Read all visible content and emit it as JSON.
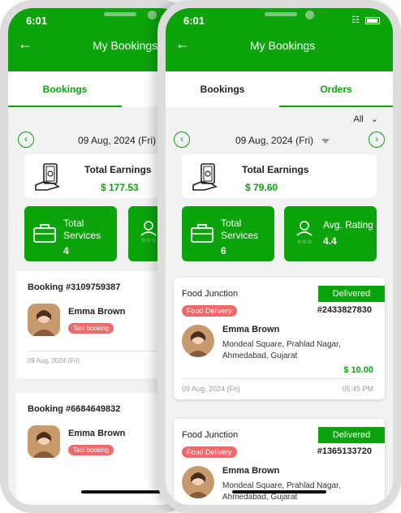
{
  "status": {
    "time": "6:01"
  },
  "header": {
    "title": "My Bookings"
  },
  "tabs_back": [
    {
      "label": "Bookings"
    }
  ],
  "tabs_front": [
    {
      "label": "Bookings"
    },
    {
      "label": "Orders"
    }
  ],
  "filter": {
    "label": "All"
  },
  "date": {
    "label": "09 Aug, 2024 (Fri)"
  },
  "earnings_back": {
    "label": "Total Earnings",
    "value": "$ 177.53"
  },
  "earnings_front": {
    "label": "Total Earnings",
    "value": "$ 79.60"
  },
  "services_back": {
    "label_line1": "Total",
    "label_line2": "Services",
    "value": "4"
  },
  "services_front": {
    "label_line1": "Total",
    "label_line2": "Services",
    "value": "6"
  },
  "rating_front": {
    "label": "Avg. Rating",
    "value": "4.4"
  },
  "bookings": [
    {
      "title": "Booking #3109759387",
      "name": "Emma Brown",
      "tag": "Taxi booking",
      "date": "09 Aug, 2024 (Fri)"
    },
    {
      "title": "Booking #6684649832",
      "name": "Emma Brown",
      "tag": "Taxi booking"
    }
  ],
  "orders": [
    {
      "restaurant": "Food Junction",
      "status": "Delivered",
      "tag": "Food Delivery",
      "id": "#2433827830",
      "name": "Emma Brown",
      "addr1": "Mondeal Square, Prahlad Nagar,",
      "addr2": "Ahmedabad, Gujarat",
      "amount": "$ 10.00",
      "date": "09 Aug, 2024 (Fri)",
      "time": "05:45 PM"
    },
    {
      "restaurant": "Food Junction",
      "status": "Delivered",
      "tag": "Food Delivery",
      "id": "#1365133720",
      "name": "Emma Brown",
      "addr1": "Mondeal Square, Prahlad Nagar,",
      "addr2": "Ahmedabad, Gujarat"
    }
  ],
  "colors": {
    "brand": "#0ca30c",
    "tag": "#ee6a6a"
  }
}
